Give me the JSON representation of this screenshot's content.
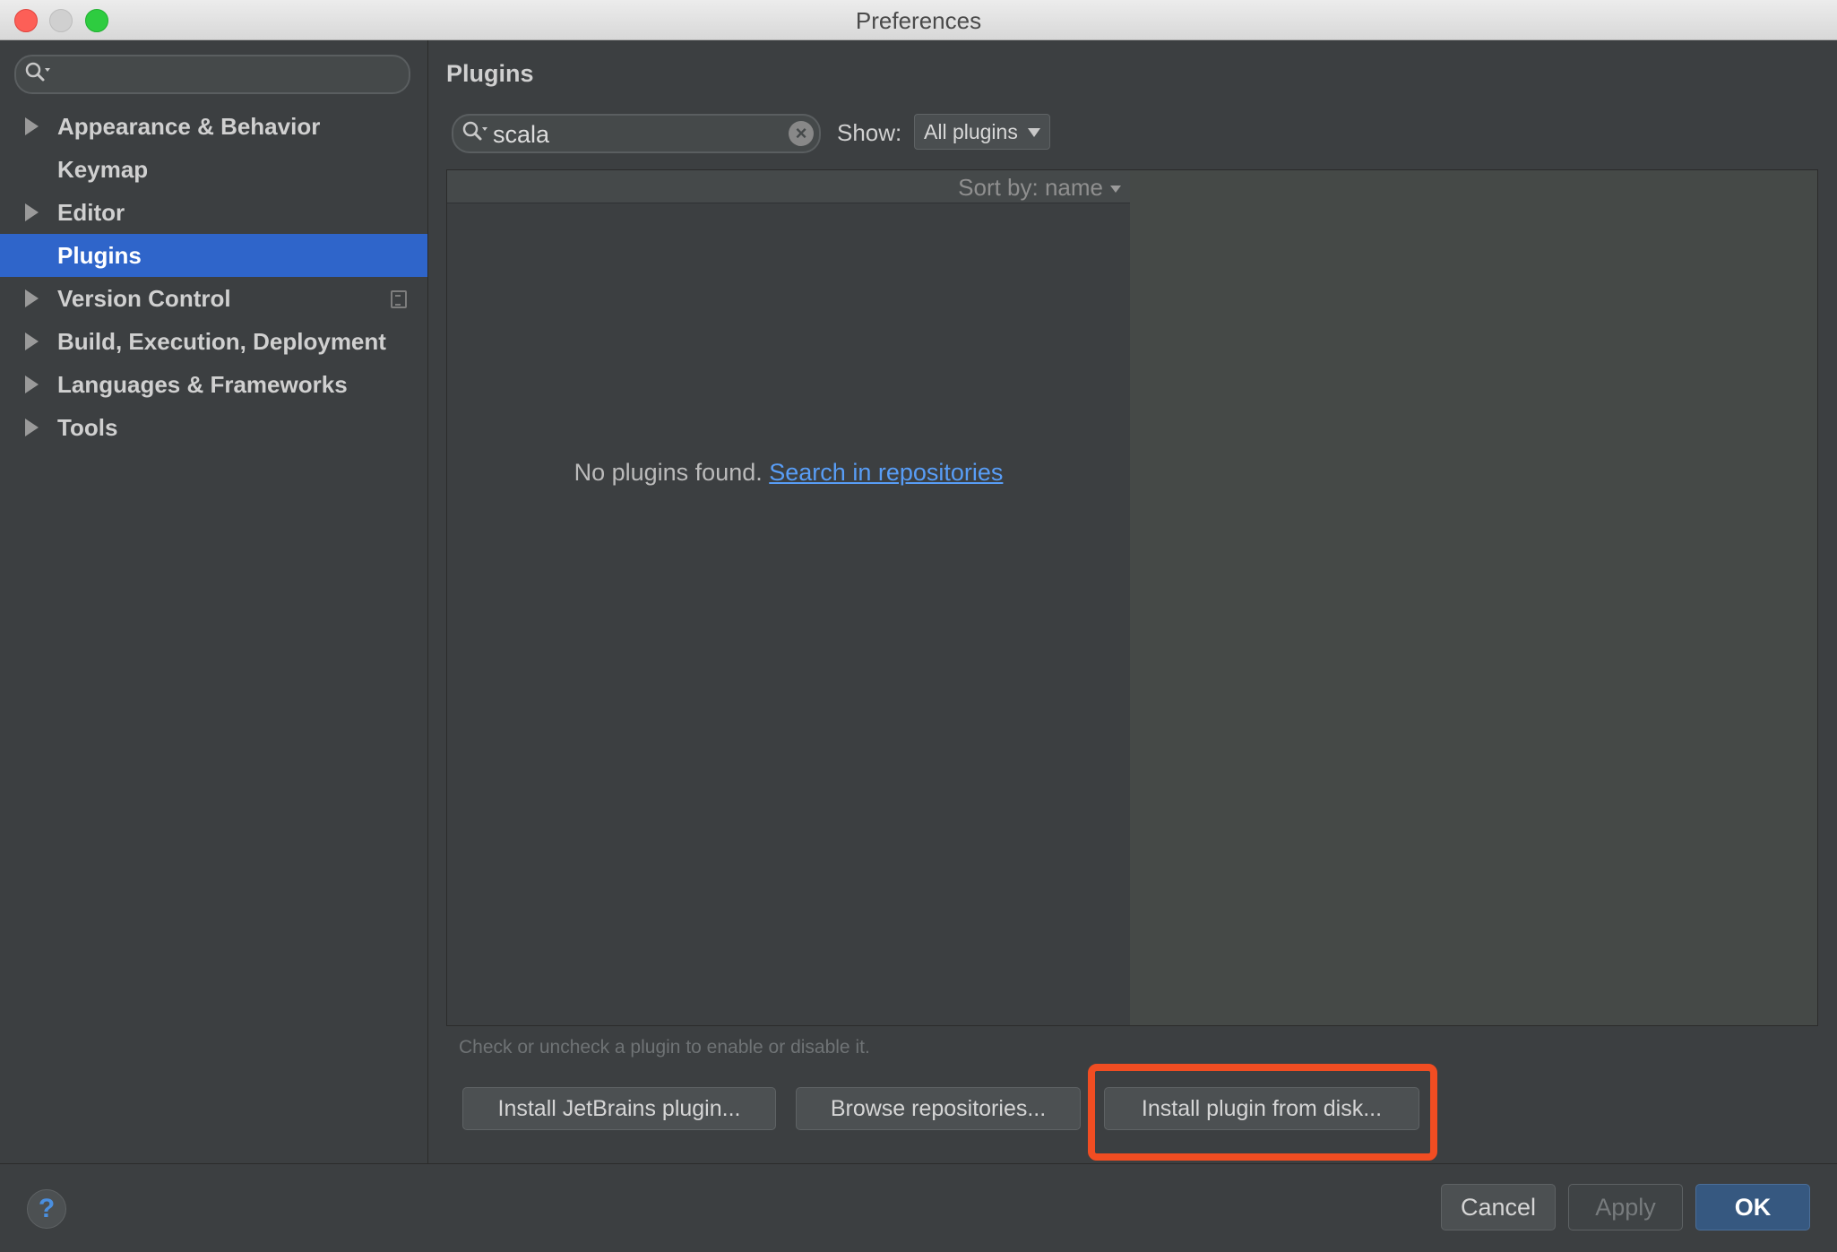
{
  "window": {
    "title": "Preferences"
  },
  "sidebar": {
    "search": {
      "value": "",
      "placeholder": ""
    },
    "items": [
      {
        "label": "Appearance & Behavior",
        "expandable": true,
        "selected": false
      },
      {
        "label": "Keymap",
        "expandable": false,
        "selected": false
      },
      {
        "label": "Editor",
        "expandable": true,
        "selected": false
      },
      {
        "label": "Plugins",
        "expandable": false,
        "selected": true
      },
      {
        "label": "Version Control",
        "expandable": true,
        "selected": false
      },
      {
        "label": "Build, Execution, Deployment",
        "expandable": true,
        "selected": false
      },
      {
        "label": "Languages & Frameworks",
        "expandable": true,
        "selected": false
      },
      {
        "label": "Tools",
        "expandable": true,
        "selected": false
      }
    ]
  },
  "main": {
    "title": "Plugins",
    "search": {
      "value": "scala"
    },
    "show": {
      "label": "Show:",
      "selected": "All plugins"
    },
    "list": {
      "sort_label": "Sort by: name",
      "empty_text": "No plugins found.",
      "empty_link": "Search in repositories"
    },
    "hint": "Check or uncheck a plugin to enable or disable it.",
    "buttons": {
      "install_jetbrains": "Install JetBrains plugin...",
      "browse_repositories": "Browse repositories...",
      "install_from_disk": "Install plugin from disk..."
    }
  },
  "footer": {
    "help": "?",
    "cancel": "Cancel",
    "apply": "Apply",
    "ok": "OK"
  },
  "colors": {
    "selection": "#2f65ca",
    "link": "#589df6",
    "highlight": "#f14d22",
    "ok_button": "#365880"
  }
}
